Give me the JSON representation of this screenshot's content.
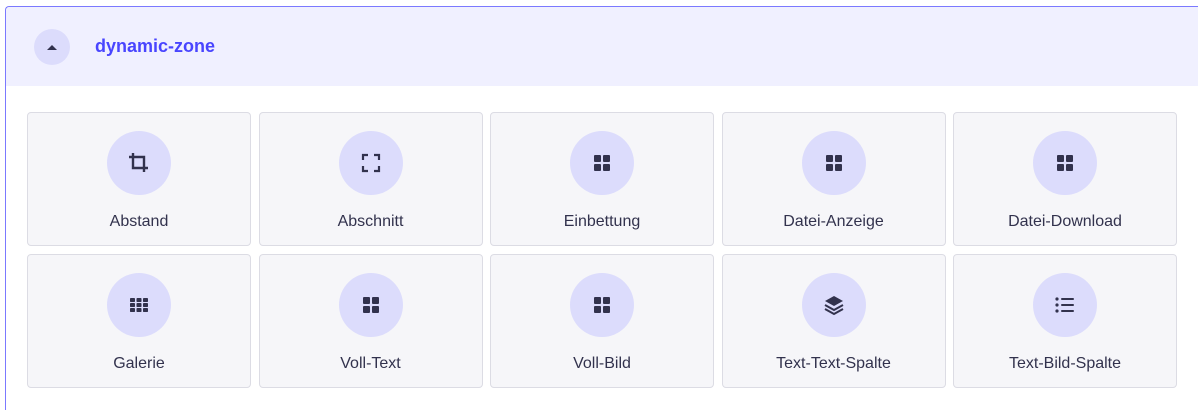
{
  "zone": {
    "title": "dynamic-zone",
    "toggle_icon": "caret-up-icon"
  },
  "colors": {
    "accent": "#4945ff",
    "header_bg": "#f0f0ff",
    "icon_circle": "#dcdcfc",
    "card_bg": "#f6f6f9",
    "card_border": "#dcdce4",
    "label_text": "#32324d",
    "icon_color": "#32324d"
  },
  "components": [
    {
      "label": "Abstand",
      "icon": "crop-icon"
    },
    {
      "label": "Abschnitt",
      "icon": "expand-icon"
    },
    {
      "label": "Einbettung",
      "icon": "grid-icon"
    },
    {
      "label": "Datei-Anzeige",
      "icon": "grid-icon"
    },
    {
      "label": "Datei-Download",
      "icon": "grid-icon"
    },
    {
      "label": "Galerie",
      "icon": "apps-icon"
    },
    {
      "label": "Voll-Text",
      "icon": "grid-icon"
    },
    {
      "label": "Voll-Bild",
      "icon": "grid-icon"
    },
    {
      "label": "Text-Text-Spalte",
      "icon": "layers-icon"
    },
    {
      "label": "Text-Bild-Spalte",
      "icon": "list-icon"
    }
  ]
}
